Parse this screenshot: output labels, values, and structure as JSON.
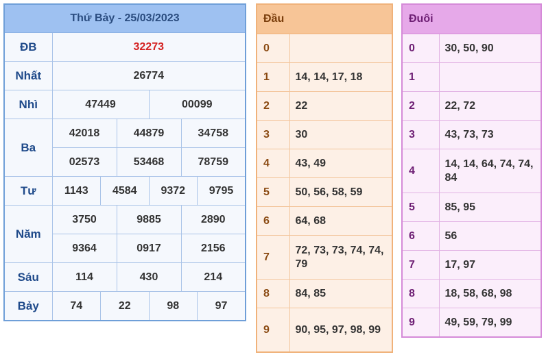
{
  "results": {
    "title": "Thứ Bảy - 25/03/2023",
    "labels": {
      "db": "ĐB",
      "nhat": "Nhất",
      "nhi": "Nhì",
      "ba": "Ba",
      "tu": "Tư",
      "nam": "Năm",
      "sau": "Sáu",
      "bay": "Bảy"
    },
    "db": "32273",
    "nhat": "26774",
    "nhi": [
      "47449",
      "00099"
    ],
    "ba": [
      "42018",
      "44879",
      "34758",
      "02573",
      "53468",
      "78759"
    ],
    "tu": [
      "1143",
      "4584",
      "9372",
      "9795"
    ],
    "nam": [
      "3750",
      "9885",
      "2890",
      "9364",
      "0917",
      "2156"
    ],
    "sau": [
      "114",
      "430",
      "214"
    ],
    "bay": [
      "74",
      "22",
      "98",
      "97"
    ]
  },
  "head": {
    "title": "Đầu",
    "rows": [
      {
        "k": "0",
        "v": ""
      },
      {
        "k": "1",
        "v": "14, 14, 17, 18"
      },
      {
        "k": "2",
        "v": "22"
      },
      {
        "k": "3",
        "v": "30"
      },
      {
        "k": "4",
        "v": "43, 49"
      },
      {
        "k": "5",
        "v": "50, 56, 58, 59"
      },
      {
        "k": "6",
        "v": "64, 68"
      },
      {
        "k": "7",
        "v": "72, 73, 73, 74, 74, 79"
      },
      {
        "k": "8",
        "v": "84, 85"
      },
      {
        "k": "9",
        "v": "90, 95, 97, 98, 99"
      }
    ]
  },
  "tail": {
    "title": "Đuôi",
    "rows": [
      {
        "k": "0",
        "v": "30, 50, 90"
      },
      {
        "k": "1",
        "v": ""
      },
      {
        "k": "2",
        "v": "22, 72"
      },
      {
        "k": "3",
        "v": "43, 73, 73"
      },
      {
        "k": "4",
        "v": "14, 14, 64, 74, 74, 84"
      },
      {
        "k": "5",
        "v": "85, 95"
      },
      {
        "k": "6",
        "v": "56"
      },
      {
        "k": "7",
        "v": "17, 97"
      },
      {
        "k": "8",
        "v": "18, 58, 68, 98"
      },
      {
        "k": "9",
        "v": "49, 59, 79, 99"
      }
    ]
  }
}
